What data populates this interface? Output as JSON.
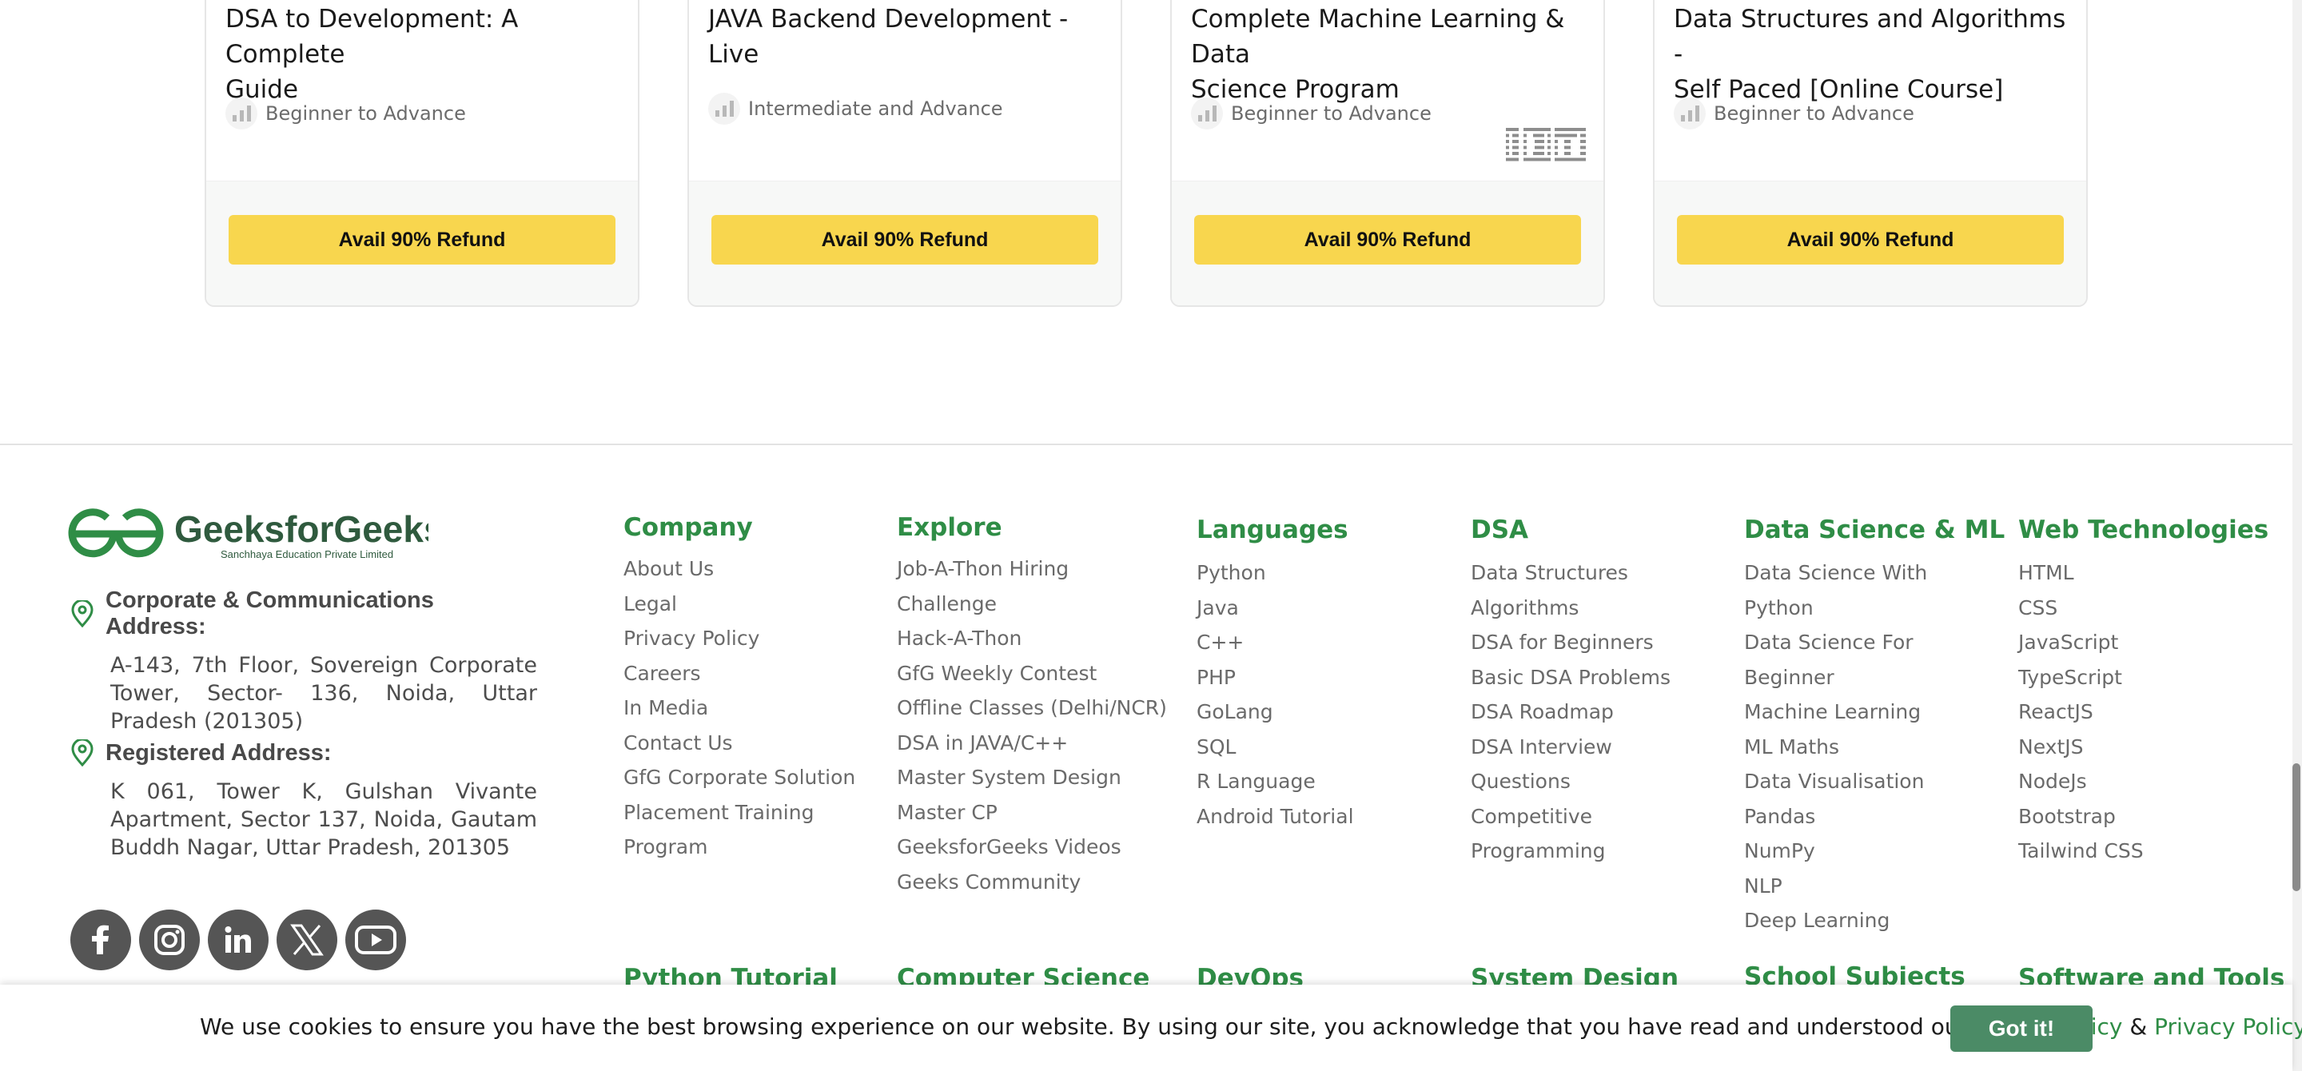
{
  "courses": [
    {
      "title_line1": "DSA to Development: A Complete",
      "title_line2": "Guide",
      "level": "Beginner to Advance",
      "button": "Avail 90% Refund"
    },
    {
      "title_line1": "JAVA Backend Development - Live",
      "title_line2": "",
      "level": "Intermediate and Advance",
      "button": "Avail 90% Refund"
    },
    {
      "title_line1": "Complete Machine Learning & Data",
      "title_line2": "Science Program",
      "level": "Beginner to Advance",
      "button": "Avail 90% Refund",
      "partner_logo": "IBM"
    },
    {
      "title_line1": "Data Structures and Algorithms -",
      "title_line2": "Self Paced [Online Course]",
      "level": "Beginner to Advance",
      "button": "Avail 90% Refund"
    }
  ],
  "brand": {
    "name": "GeeksforGeeks",
    "tagline": "Sanchhaya Education Private Limited",
    "green": "#2f8d46"
  },
  "addresses": {
    "corporate_head": "Corporate & Communications Address:",
    "corporate_text": "A-143, 7th Floor, Sovereign Corporate Tower, Sector- 136, Noida, Uttar Pradesh (201305)",
    "registered_head": "Registered Address:",
    "registered_text": "K 061, Tower K, Gulshan Vivante Apartment, Sector 137, Noida, Gautam Buddh Nagar, Uttar Pradesh, 201305"
  },
  "socials": [
    "facebook-icon",
    "instagram-icon",
    "linkedin-icon",
    "x-icon",
    "youtube-icon"
  ],
  "columns": [
    {
      "head": "Company",
      "links": [
        "About Us",
        "Legal",
        "Privacy Policy",
        "Careers",
        "In Media",
        "Contact Us",
        "GfG Corporate Solution",
        "Placement Training",
        "Program"
      ]
    },
    {
      "head": "Explore",
      "links": [
        "Job-A-Thon Hiring",
        "Challenge",
        "Hack-A-Thon",
        "GfG Weekly Contest",
        "Offline Classes (Delhi/NCR)",
        "DSA in JAVA/C++",
        "Master System Design",
        "Master CP",
        "GeeksforGeeks Videos",
        "Geeks Community"
      ]
    },
    {
      "head": "Languages",
      "links": [
        "Python",
        "Java",
        "C++",
        "PHP",
        "GoLang",
        "SQL",
        "R Language",
        "Android Tutorial"
      ]
    },
    {
      "head": "DSA",
      "links": [
        "Data Structures",
        "Algorithms",
        "DSA for Beginners",
        "Basic DSA Problems",
        "DSA Roadmap",
        "DSA Interview",
        "Questions",
        "Competitive",
        "Programming"
      ]
    },
    {
      "head": "Data Science & ML",
      "links": [
        "Data Science With",
        "Python",
        "Data Science For",
        "Beginner",
        "Machine Learning",
        "ML Maths",
        "Data Visualisation",
        "Pandas",
        "NumPy",
        "NLP",
        "Deep Learning"
      ]
    },
    {
      "head": "Web Technologies",
      "links": [
        "HTML",
        "CSS",
        "JavaScript",
        "TypeScript",
        "ReactJS",
        "NextJS",
        "NodeJs",
        "Bootstrap",
        "Tailwind CSS"
      ]
    }
  ],
  "next_heads": [
    "Python Tutorial",
    "Computer Science",
    "DevOps",
    "System Design",
    "School Subjects",
    "Software and Tools"
  ],
  "cookie": {
    "text": "We use cookies to ensure you have the best browsing experience on our website. By using our site, you acknowledge that you have read and understood our ",
    "cookie_policy": "Cookie Policy",
    "amp": " & ",
    "privacy_policy": "Privacy Policy",
    "button": "Got it!"
  }
}
